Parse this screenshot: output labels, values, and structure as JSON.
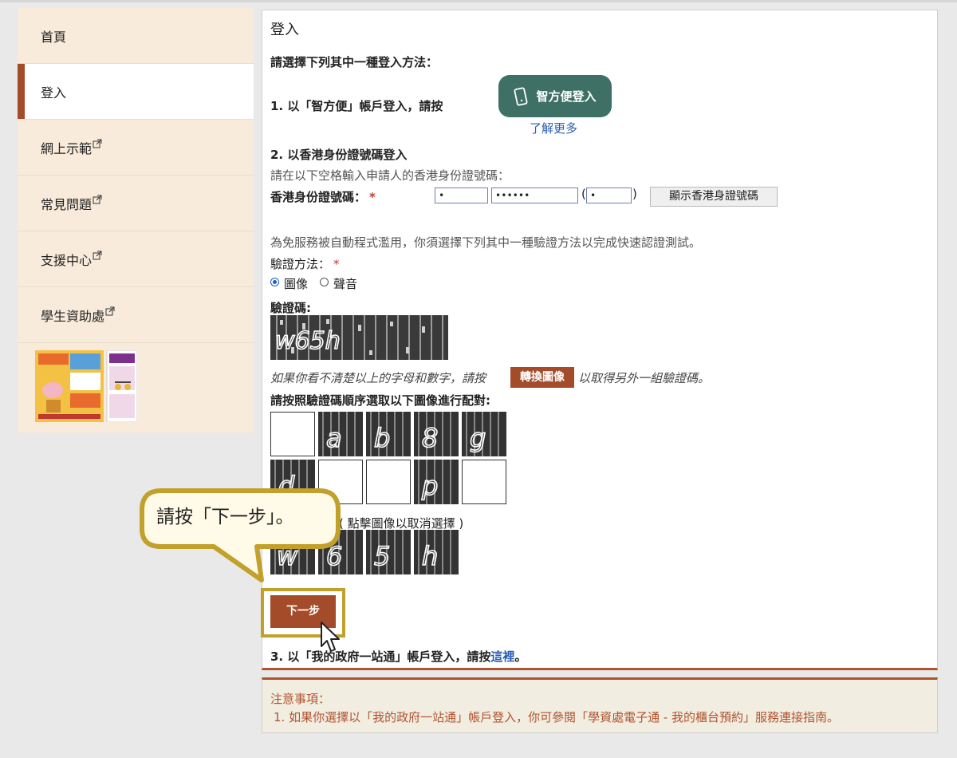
{
  "sidebar": {
    "items": [
      {
        "label": "首頁",
        "active": false,
        "external": false
      },
      {
        "label": "登入",
        "active": true,
        "external": false
      },
      {
        "label": "網上示範",
        "active": false,
        "external": true
      },
      {
        "label": "常見問題",
        "active": false,
        "external": true
      },
      {
        "label": "支援中心",
        "active": false,
        "external": true
      },
      {
        "label": "學生資助處",
        "active": false,
        "external": true
      }
    ]
  },
  "main": {
    "title": "登入",
    "choose_method": "請選擇下列其中一種登入方法：",
    "method1_text": "1. 以「智方便」帳戶登入，請按",
    "iamsmart_button": "智方便登入",
    "learn_more": "了解更多",
    "method2_title": "2. 以香港身份證號碼登入",
    "method2_hint": "請在以下空格輸入申請人的香港身份證號碼：",
    "hkid_label": "香港身份證號碼：",
    "required_mark": "*",
    "hkid_part1": "•",
    "hkid_part2": "••••••",
    "hkid_check": "•",
    "paren_open": "(",
    "paren_close": ")",
    "show_hkid_button": "顯示香港身證號碼",
    "anti_bot_text": "為免服務被自動程式濫用，你須選擇下列其中一種驗證方法以完成快速認證測試。",
    "verify_method_label": "驗證方法：",
    "option_image": "圖像",
    "option_audio": "聲音",
    "selected_option": "圖像",
    "captcha_label": "驗證碼:",
    "captcha_text": "w65h",
    "unclear_prefix": "如果你看不清楚以上的字母和數字，請按",
    "switch_image_button": "轉換圖像",
    "unclear_suffix": "以取得另外一組驗證碼。",
    "match_instruction": "請按照驗證碼順序選取以下圖像進行配對:",
    "tiles_row1": [
      "",
      "a",
      "b",
      "8",
      "g"
    ],
    "tiles_row2": [
      "d",
      "",
      "",
      "p",
      ""
    ],
    "deselect_hint": "( 點擊圖像以取消選擇 )",
    "selected_tiles": [
      "w",
      "6",
      "5",
      "h"
    ],
    "next_button": "下一步",
    "method3_prefix": "3. 以「我的政府一站通」帳戶登入，請按",
    "method3_link": "這裡",
    "method3_suffix": "。"
  },
  "notice": {
    "title": "注意事項：",
    "item1": "1. 如果你選擇以「我的政府一站通」帳戶登入，你可參閱「學資處電子通 - 我的櫃台預約」服務連接指南。"
  },
  "callout": {
    "text": "請按「下一步」。"
  },
  "colors": {
    "brand": "#a44b2a",
    "sidebar_bg": "#f8ebdb",
    "iamsmart": "#3e7065",
    "link": "#2a5db0",
    "callout_border": "#c1a12c",
    "callout_fill": "#fffbe8"
  }
}
